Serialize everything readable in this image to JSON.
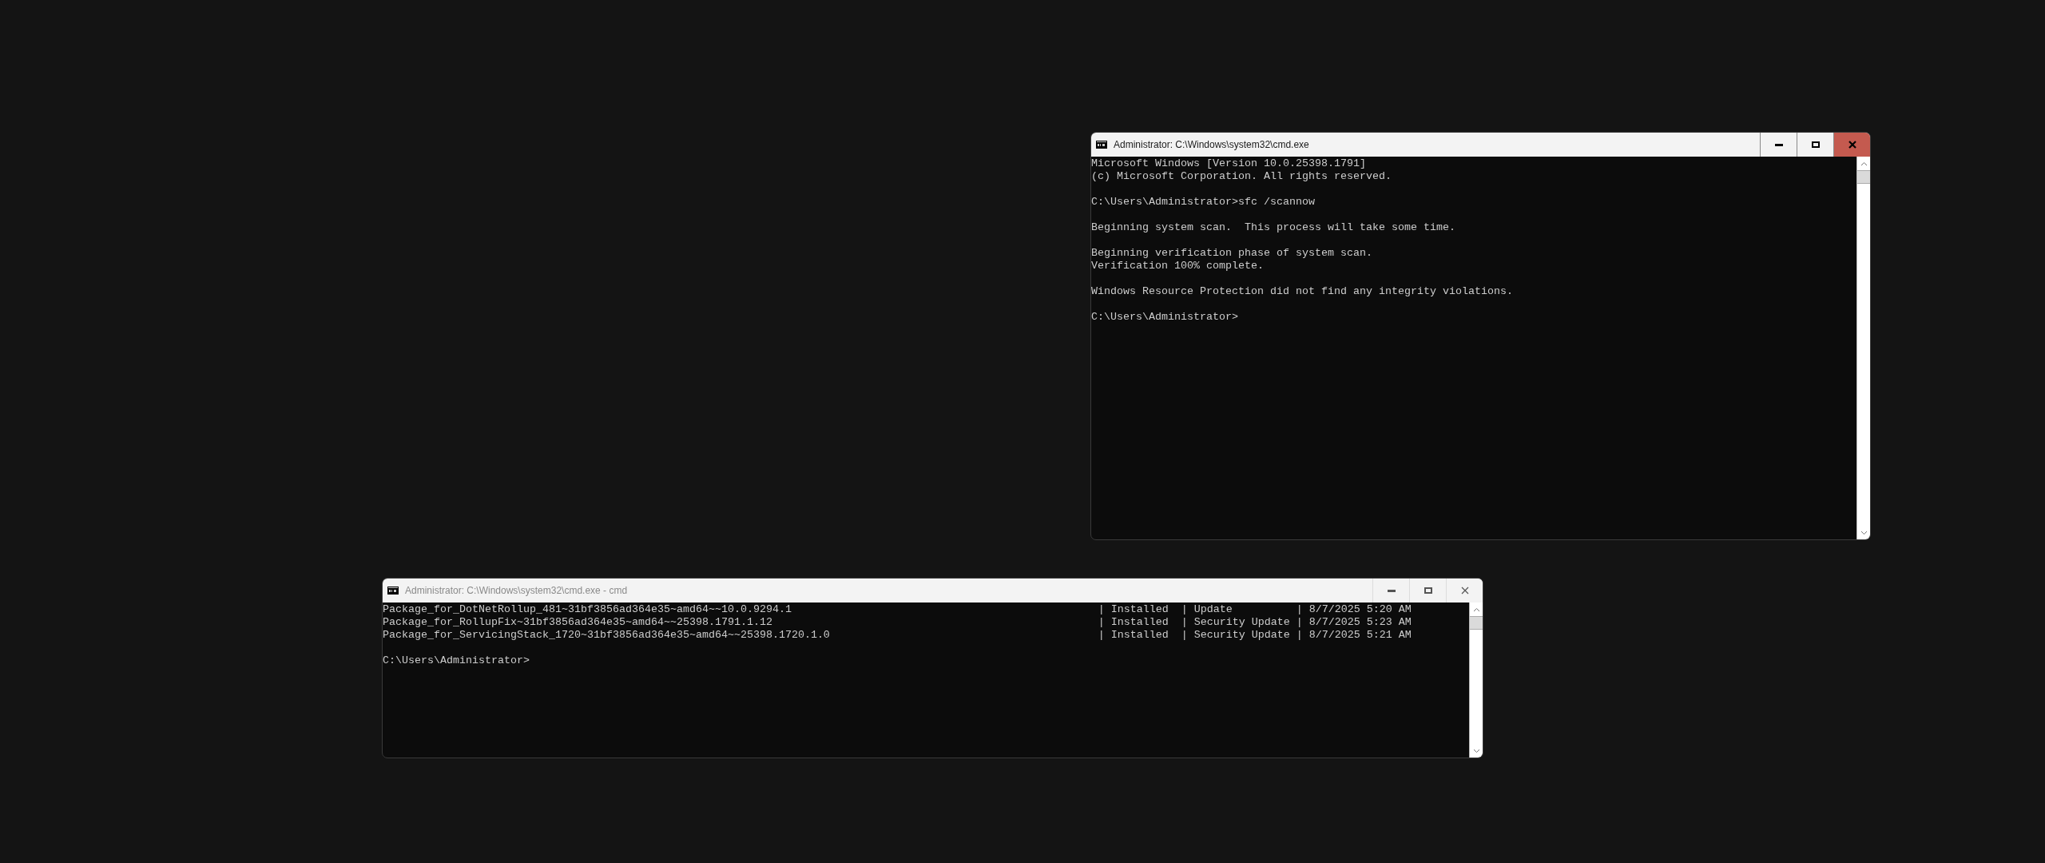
{
  "windows": [
    {
      "title": "Administrator: C:\\Windows\\system32\\cmd.exe",
      "active": true,
      "blocks": [
        {
          "kind": "text",
          "lines": [
            "Microsoft Windows [Version 10.0.25398.1791]",
            "(c) Microsoft Corporation. All rights reserved."
          ]
        },
        {
          "kind": "text",
          "lines": [
            "C:\\Users\\Administrator>sfc /scannow"
          ]
        },
        {
          "kind": "text",
          "lines": [
            "Beginning system scan.  This process will take some time."
          ]
        },
        {
          "kind": "text",
          "lines": [
            "Beginning verification phase of system scan.",
            "Verification 100% complete."
          ]
        },
        {
          "kind": "text",
          "lines": [
            "Windows Resource Protection did not find any integrity violations."
          ]
        },
        {
          "kind": "text",
          "lines": [
            "C:\\Users\\Administrator>"
          ]
        }
      ]
    },
    {
      "title": "Administrator: C:\\Windows\\system32\\cmd.exe - cmd",
      "active": false,
      "blocks": [
        {
          "kind": "table",
          "rows": [
            {
              "package": "Package_for_DotNetRollup_481~31bf3856ad364e35~amd64~~10.0.9294.1",
              "details": "| Installed  | Update          | 8/7/2025 5:20 AM"
            },
            {
              "package": "Package_for_RollupFix~31bf3856ad364e35~amd64~~25398.1791.1.12",
              "details": "| Installed  | Security Update | 8/7/2025 5:23 AM"
            },
            {
              "package": "Package_for_ServicingStack_1720~31bf3856ad364e35~amd64~~25398.1720.1.0",
              "details": "| Installed  | Security Update | 8/7/2025 5:21 AM"
            }
          ]
        },
        {
          "kind": "text",
          "lines": [
            "C:\\Users\\Administrator>"
          ]
        }
      ]
    }
  ]
}
